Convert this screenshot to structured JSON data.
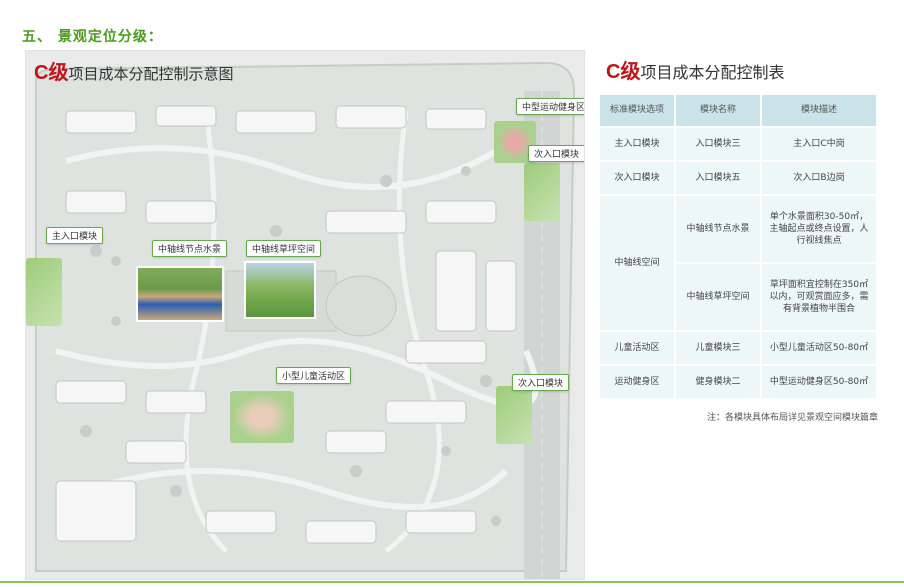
{
  "section": {
    "title": "五、 景观定位分级："
  },
  "map": {
    "title_letter": "C级",
    "title_rest": "项目成本分配控制示意图",
    "tags": {
      "main_entry": "主入口模块",
      "axis_water": "中轴线节点水景",
      "axis_lawn": "中轴线草坪空间",
      "fitness_mid": "中型运动健身区",
      "secondary_entry_1": "次入口模块",
      "secondary_entry_2": "次入口模块",
      "kids_small": "小型儿童活动区"
    }
  },
  "table": {
    "title_letter": "C级",
    "title_rest": "项目成本分配控制表",
    "headers": [
      "标准模块选项",
      "模块名称",
      "模块描述"
    ],
    "rows": [
      {
        "option": "主入口模块",
        "name": "入口模块三",
        "desc": "主入口C中岗"
      },
      {
        "option": "次入口模块",
        "name": "入口模块五",
        "desc": "次入口B边岗"
      },
      {
        "option": "中轴线空间",
        "name": "中轴线节点水景",
        "desc": "单个水景面积30-50㎡，主轴起点或终点设置，人行视线焦点"
      },
      {
        "option": "",
        "name": "中轴线草坪空间",
        "desc": "草坪面积宜控制在350㎡以内，可观赏面应多，需有背景植物半围合"
      },
      {
        "option": "儿童活动区",
        "name": "儿童模块三",
        "desc": "小型儿童活动区50-80㎡"
      },
      {
        "option": "运动健身区",
        "name": "健身模块二",
        "desc": "中型运动健身区50-80㎡"
      }
    ],
    "note": "注：各模块具体布局详见景观空间模块篇章"
  },
  "colors": {
    "accent_green": "#4a9a1e",
    "title_red": "#c0141b",
    "header_bg": "#c9e3e8",
    "cell_bg": "#eef7f8"
  }
}
